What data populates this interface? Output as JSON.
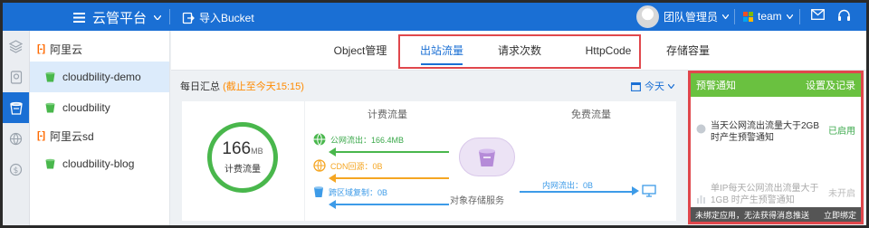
{
  "app": {
    "title": "云管平台"
  },
  "topbar": {
    "import_label": "导入Bucket",
    "user_name": "团队管理员",
    "team_name": "team"
  },
  "sidebar": {
    "groups": [
      {
        "label": "阿里云",
        "items": [
          {
            "label": "cloudbility-demo",
            "active": true
          },
          {
            "label": "cloudbility",
            "active": false
          }
        ]
      },
      {
        "label": "阿里云sd",
        "items": [
          {
            "label": "cloudbility-blog",
            "active": false
          }
        ]
      }
    ]
  },
  "tabs": [
    {
      "label": "Object管理",
      "active": false
    },
    {
      "label": "出站流量",
      "active": true
    },
    {
      "label": "请求次数",
      "active": false
    },
    {
      "label": "HttpCode",
      "active": false
    },
    {
      "label": "存储容量",
      "active": false
    }
  ],
  "summary": {
    "title": "每日汇总",
    "note": "(截止至今天15:15)",
    "date_filter": "今天"
  },
  "traffic": {
    "total_value": "166",
    "total_unit": "MB",
    "total_label": "计费流量",
    "billed_header": "计费流量",
    "free_header": "免费流量",
    "public_out": "公网流出：166.4MB",
    "cdn_back": "CDN回源：0B",
    "cross_region": "跨区域复制：0B",
    "intranet_out": "内网流出：0B",
    "storage_label": "对象存储服务"
  },
  "alerts": {
    "title": "预警通知",
    "settings_label": "设置及记录",
    "rules": [
      {
        "text": "当天公网流出流量大于2GB 时产生预警通知",
        "status": "已启用",
        "enabled": true
      },
      {
        "text": "单IP每天公网流出流量大于1GB 时产生预警通知",
        "status": "未开启",
        "enabled": false
      }
    ],
    "footer_text": "未绑定应用，无法获得消息推送",
    "bind_label": "立即绑定"
  },
  "colors": {
    "brand_blue": "#1a6fd4",
    "green": "#49b74c",
    "orange": "#f5a623",
    "aliyun_orange": "#ff6a00",
    "highlight_red": "#e0474c"
  }
}
